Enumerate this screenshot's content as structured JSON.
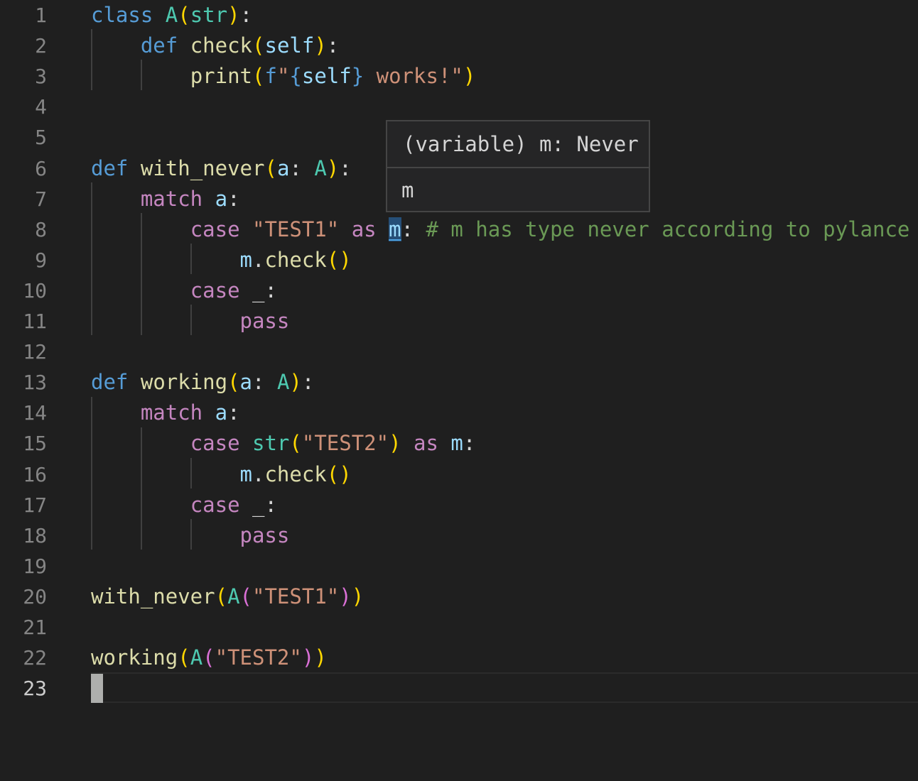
{
  "editor": {
    "active_line": 23,
    "lines": [
      {
        "n": "1",
        "tokens": [
          [
            "kw",
            "class"
          ],
          [
            "",
            "&nbsp;"
          ],
          [
            "cls",
            "A"
          ],
          [
            "p1",
            "("
          ],
          [
            "cls",
            "str"
          ],
          [
            "p1",
            ")"
          ],
          [
            "",
            ":"
          ]
        ]
      },
      {
        "n": "2",
        "tokens": [
          [
            "",
            "    "
          ],
          [
            "kw",
            "def"
          ],
          [
            "",
            " "
          ],
          [
            "fn",
            "check"
          ],
          [
            "p1",
            "("
          ],
          [
            "var",
            "self"
          ],
          [
            "p1",
            ")"
          ],
          [
            "",
            ":"
          ]
        ]
      },
      {
        "n": "3",
        "tokens": [
          [
            "",
            "        "
          ],
          [
            "fn",
            "print"
          ],
          [
            "p1",
            "("
          ],
          [
            "kw",
            "f"
          ],
          [
            "str",
            "\""
          ],
          [
            "kw",
            "{"
          ],
          [
            "var",
            "self"
          ],
          [
            "kw",
            "}"
          ],
          [
            "str",
            " works!\""
          ],
          [
            "p1",
            ")"
          ]
        ]
      },
      {
        "n": "4",
        "tokens": []
      },
      {
        "n": "5",
        "tokens": []
      },
      {
        "n": "6",
        "tokens": [
          [
            "kw",
            "def"
          ],
          [
            "",
            " "
          ],
          [
            "fn",
            "with_never"
          ],
          [
            "p1",
            "("
          ],
          [
            "var",
            "a"
          ],
          [
            "",
            ": "
          ],
          [
            "cls",
            "A"
          ],
          [
            "p1",
            ")"
          ],
          [
            "",
            ":"
          ]
        ]
      },
      {
        "n": "7",
        "tokens": [
          [
            "",
            "    "
          ],
          [
            "ctl",
            "match"
          ],
          [
            "",
            " "
          ],
          [
            "var",
            "a"
          ],
          [
            "",
            ":"
          ]
        ]
      },
      {
        "n": "8",
        "tokens": [
          [
            "",
            "        "
          ],
          [
            "ctl",
            "case"
          ],
          [
            "",
            " "
          ],
          [
            "str",
            "\"TEST1\""
          ],
          [
            "",
            " "
          ],
          [
            "ctl",
            "as"
          ],
          [
            "",
            " "
          ],
          [
            "hl var",
            "m"
          ],
          [
            "",
            ": "
          ],
          [
            "cm",
            "# m has type never according to pylance"
          ]
        ]
      },
      {
        "n": "9",
        "tokens": [
          [
            "",
            "            "
          ],
          [
            "var",
            "m"
          ],
          [
            "",
            "."
          ],
          [
            "fn",
            "check"
          ],
          [
            "p1",
            "()"
          ]
        ]
      },
      {
        "n": "10",
        "tokens": [
          [
            "",
            "        "
          ],
          [
            "ctl",
            "case"
          ],
          [
            "",
            " _:"
          ]
        ]
      },
      {
        "n": "11",
        "tokens": [
          [
            "",
            "            "
          ],
          [
            "ctl",
            "pass"
          ]
        ]
      },
      {
        "n": "12",
        "tokens": []
      },
      {
        "n": "13",
        "tokens": [
          [
            "kw",
            "def"
          ],
          [
            "",
            " "
          ],
          [
            "fn",
            "working"
          ],
          [
            "p1",
            "("
          ],
          [
            "var",
            "a"
          ],
          [
            "",
            ": "
          ],
          [
            "cls",
            "A"
          ],
          [
            "p1",
            ")"
          ],
          [
            "",
            ":"
          ]
        ]
      },
      {
        "n": "14",
        "tokens": [
          [
            "",
            "    "
          ],
          [
            "ctl",
            "match"
          ],
          [
            "",
            " "
          ],
          [
            "var",
            "a"
          ],
          [
            "",
            ":"
          ]
        ]
      },
      {
        "n": "15",
        "tokens": [
          [
            "",
            "        "
          ],
          [
            "ctl",
            "case"
          ],
          [
            "",
            " "
          ],
          [
            "cls",
            "str"
          ],
          [
            "p1",
            "("
          ],
          [
            "str",
            "\"TEST2\""
          ],
          [
            "p1",
            ")"
          ],
          [
            "",
            " "
          ],
          [
            "ctl",
            "as"
          ],
          [
            "",
            " "
          ],
          [
            "var",
            "m"
          ],
          [
            "",
            ":"
          ]
        ]
      },
      {
        "n": "16",
        "tokens": [
          [
            "",
            "            "
          ],
          [
            "var",
            "m"
          ],
          [
            "",
            "."
          ],
          [
            "fn",
            "check"
          ],
          [
            "p1",
            "()"
          ]
        ]
      },
      {
        "n": "17",
        "tokens": [
          [
            "",
            "        "
          ],
          [
            "ctl",
            "case"
          ],
          [
            "",
            " _:"
          ]
        ]
      },
      {
        "n": "18",
        "tokens": [
          [
            "",
            "            "
          ],
          [
            "ctl",
            "pass"
          ]
        ]
      },
      {
        "n": "19",
        "tokens": []
      },
      {
        "n": "20",
        "tokens": [
          [
            "fn",
            "with_never"
          ],
          [
            "p1",
            "("
          ],
          [
            "cls",
            "A"
          ],
          [
            "p2",
            "("
          ],
          [
            "str",
            "\"TEST1\""
          ],
          [
            "p2",
            ")"
          ],
          [
            "p1",
            ")"
          ]
        ]
      },
      {
        "n": "21",
        "tokens": []
      },
      {
        "n": "22",
        "tokens": [
          [
            "fn",
            "working"
          ],
          [
            "p1",
            "("
          ],
          [
            "cls",
            "A"
          ],
          [
            "p2",
            "("
          ],
          [
            "str",
            "\"TEST2\""
          ],
          [
            "p2",
            ")"
          ],
          [
            "p1",
            ")"
          ]
        ]
      },
      {
        "n": "23",
        "tokens": []
      }
    ]
  },
  "hover": {
    "signature": "(variable) m: Never",
    "doc": "m"
  },
  "colors": {
    "background": "#1f1f1f",
    "keyword": "#569cd6",
    "control": "#c586c0",
    "class": "#4ec9b0",
    "function": "#dcdcaa",
    "variable": "#9cdcfe",
    "string": "#ce9178",
    "comment": "#6a9955",
    "bracket1": "#ffd700",
    "bracket2": "#da70d6"
  }
}
